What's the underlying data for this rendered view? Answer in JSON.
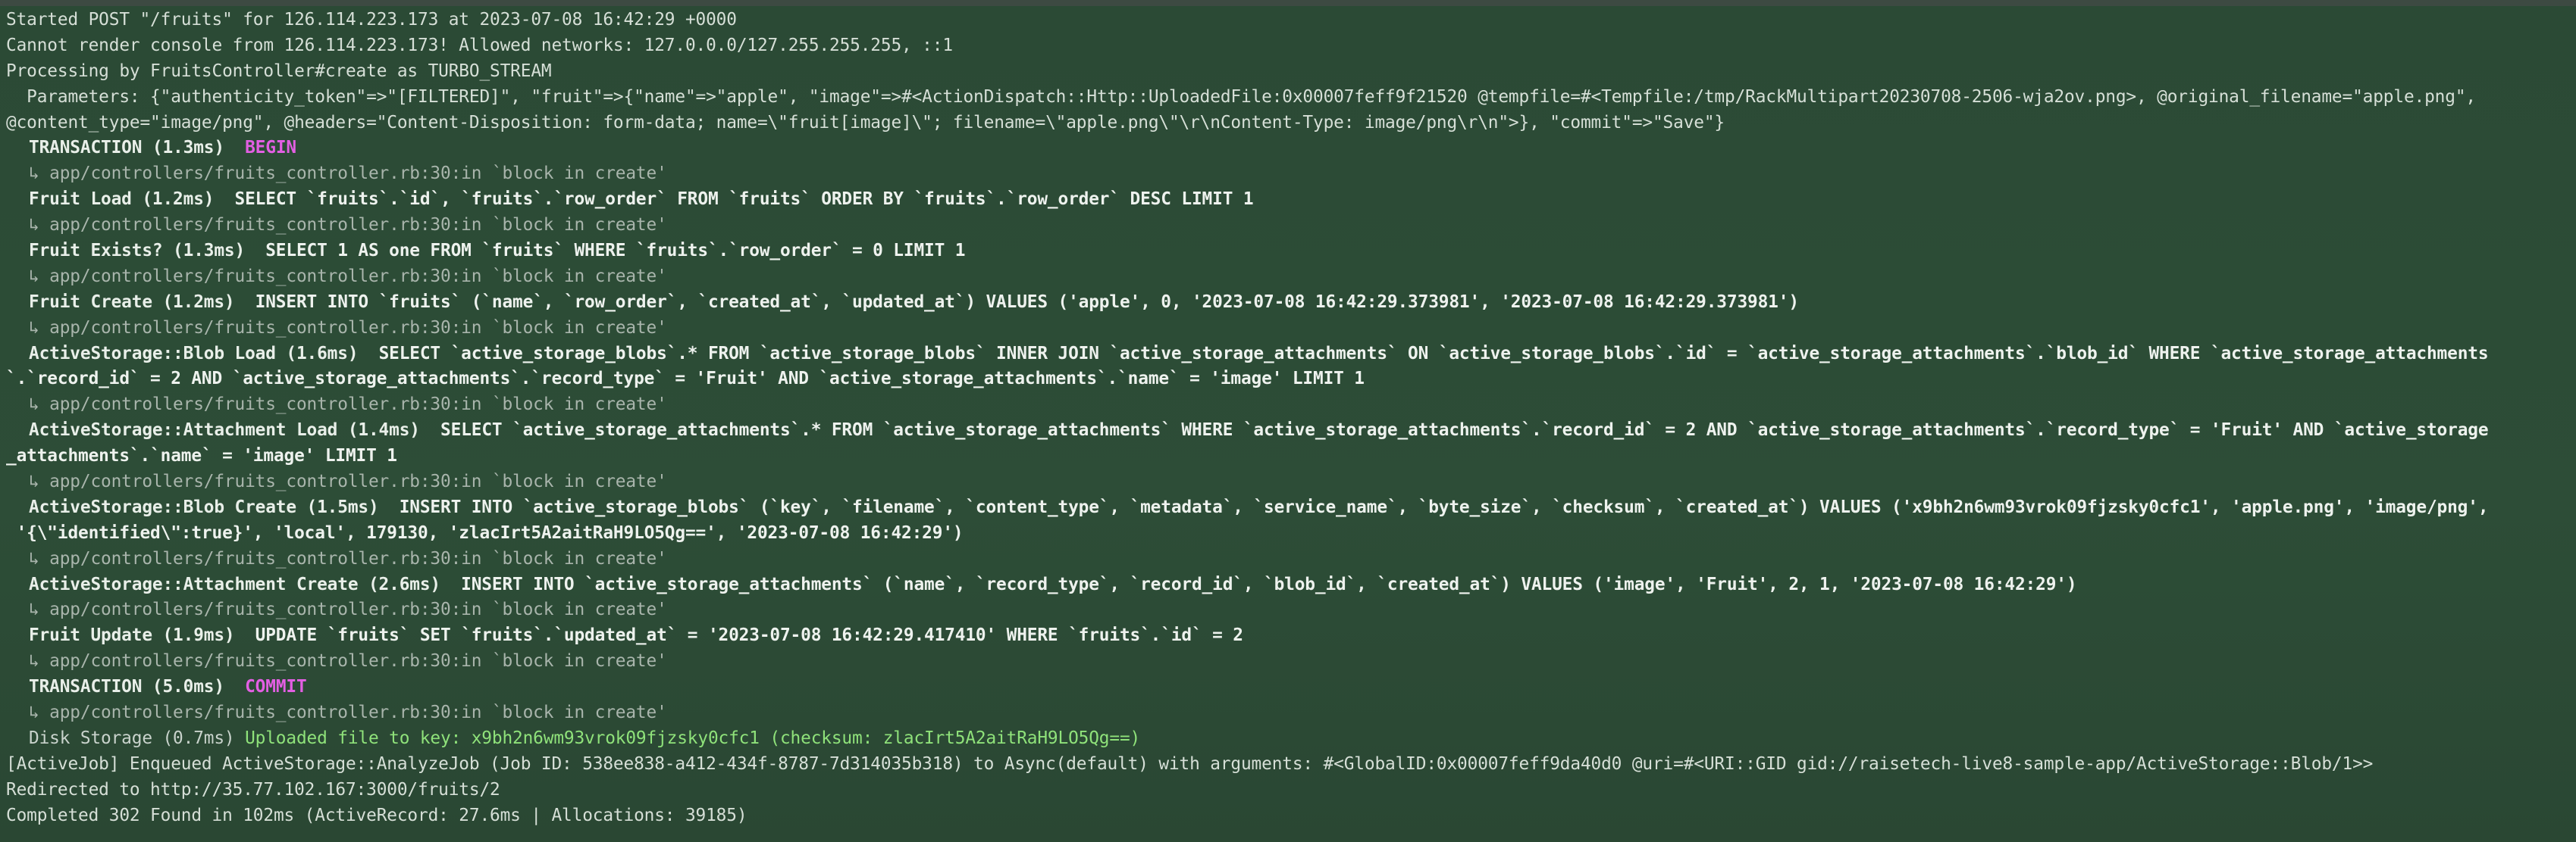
{
  "log": {
    "l1": "Started POST \"/fruits\" for 126.114.223.173 at 2023-07-08 16:42:29 +0000",
    "l2": "Cannot render console from 126.114.223.173! Allowed networks: 127.0.0.0/127.255.255.255, ::1",
    "l3": "Processing by FruitsController#create as TURBO_STREAM",
    "l4": "  Parameters: {\"authenticity_token\"=>\"[FILTERED]\", \"fruit\"=>{\"name\"=>\"apple\", \"image\"=>#<ActionDispatch::Http::UploadedFile:0x00007feff9f21520 @tempfile=#<Tempfile:/tmp/RackMultipart20230708-2506-wja2ov.png>, @original_filename=\"apple.png\",",
    "l5": "@content_type=\"image/png\", @headers=\"Content-Disposition: form-data; name=\\\"fruit[image]\\\"; filename=\\\"apple.png\\\"\\r\\nContent-Type: image/png\\r\\n\">}, \"commit\"=>\"Save\"}",
    "source_ref": "↳ app/controllers/fruits_controller.rb:30:in `block in create'",
    "tx_begin_name": "TRANSACTION (1.3ms)",
    "tx_begin_kw": "BEGIN",
    "q1_name": "Fruit Load (1.2ms)",
    "q1_sql": "SELECT `fruits`.`id`, `fruits`.`row_order` FROM `fruits` ORDER BY `fruits`.`row_order` DESC LIMIT 1",
    "q2_name": "Fruit Exists? (1.3ms)",
    "q2_sql": "SELECT 1 AS one FROM `fruits` WHERE `fruits`.`row_order` = 0 LIMIT 1",
    "q3_name": "Fruit Create (1.2ms)",
    "q3_sql": "INSERT INTO `fruits` (`name`, `row_order`, `created_at`, `updated_at`) VALUES ('apple', 0, '2023-07-08 16:42:29.373981', '2023-07-08 16:42:29.373981')",
    "q4_name": "ActiveStorage::Blob Load (1.6ms)",
    "q4_sql": "SELECT `active_storage_blobs`.* FROM `active_storage_blobs` INNER JOIN `active_storage_attachments` ON `active_storage_blobs`.`id` = `active_storage_attachments`.`blob_id` WHERE `active_storage_attachments",
    "q4_wrap": "`.`record_id` = 2 AND `active_storage_attachments`.`record_type` = 'Fruit' AND `active_storage_attachments`.`name` = 'image' LIMIT 1",
    "q5_name": "ActiveStorage::Attachment Load (1.4ms)",
    "q5_sql": "SELECT `active_storage_attachments`.* FROM `active_storage_attachments` WHERE `active_storage_attachments`.`record_id` = 2 AND `active_storage_attachments`.`record_type` = 'Fruit' AND `active_storage",
    "q5_wrap": "_attachments`.`name` = 'image' LIMIT 1",
    "q6_name": "ActiveStorage::Blob Create (1.5ms)",
    "q6_sql": "INSERT INTO `active_storage_blobs` (`key`, `filename`, `content_type`, `metadata`, `service_name`, `byte_size`, `checksum`, `created_at`) VALUES ('x9bh2n6wm93vrok09fjzsky0cfc1', 'apple.png', 'image/png',",
    "q6_wrap": " '{\\\"identified\\\":true}', 'local', 179130, 'zlacIrt5A2aitRaH9LO5Qg==', '2023-07-08 16:42:29')",
    "q7_name": "ActiveStorage::Attachment Create (2.6ms)",
    "q7_sql": "INSERT INTO `active_storage_attachments` (`name`, `record_type`, `record_id`, `blob_id`, `created_at`) VALUES ('image', 'Fruit', 2, 1, '2023-07-08 16:42:29')",
    "q8_name": "Fruit Update (1.9ms)",
    "q8_sql": "UPDATE `fruits` SET `fruits`.`updated_at` = '2023-07-08 16:42:29.417410' WHERE `fruits`.`id` = 2",
    "tx_commit_name": "TRANSACTION (5.0ms)",
    "tx_commit_kw": "COMMIT",
    "disk_prefix": "Disk Storage (0.7ms)",
    "disk_msg": "Uploaded file to key: x9bh2n6wm93vrok09fjzsky0cfc1 (checksum: zlacIrt5A2aitRaH9LO5Qg==)",
    "job": "[ActiveJob] Enqueued ActiveStorage::AnalyzeJob (Job ID: 538ee838-a412-434f-8787-7d314035b318) to Async(default) with arguments: #<GlobalID:0x00007feff9da40d0 @uri=#<URI::GID gid://raisetech-live8-sample-app/ActiveStorage::Blob/1>>",
    "redirect": "Redirected to http://35.77.102.167:3000/fruits/2",
    "completed": "Completed 302 Found in 102ms (ActiveRecord: 27.6ms | Allocations: 39185)"
  },
  "colors": {
    "background": "#2b4a35",
    "text": "#d6dfd7",
    "keyword": "#e35fe3",
    "success": "#8fe27a"
  }
}
